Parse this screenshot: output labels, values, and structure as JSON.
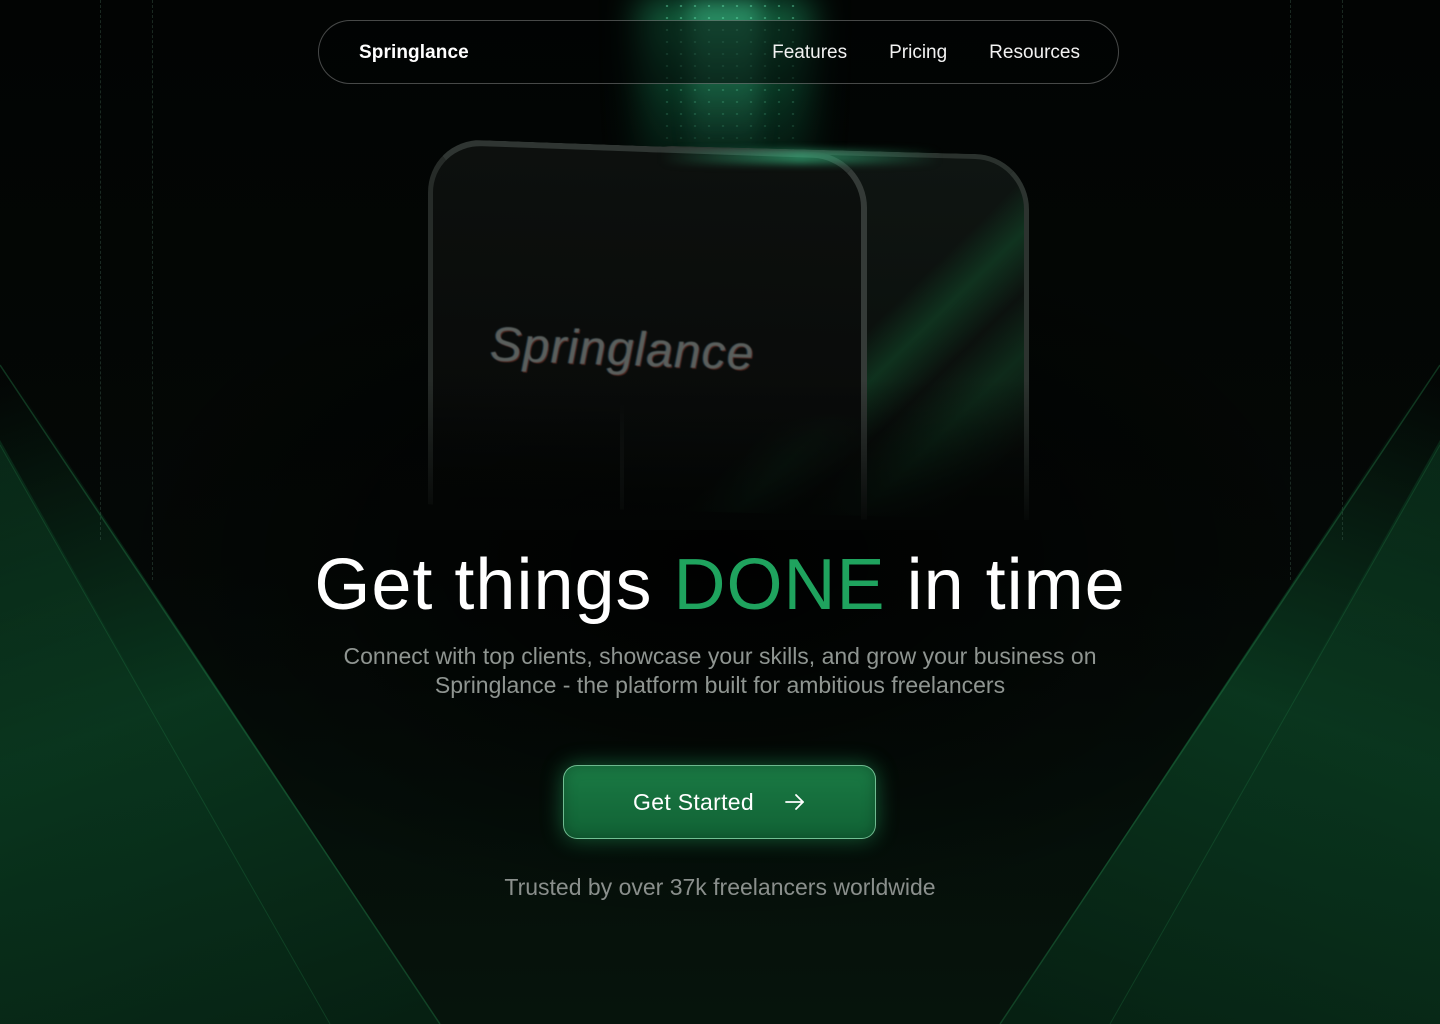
{
  "nav": {
    "brand": "Springlance",
    "links": [
      "Features",
      "Pricing",
      "Resources"
    ]
  },
  "hero": {
    "phone_logo": "Springlance",
    "headline_before": "Get things",
    "headline_accent": "DONE",
    "headline_after": "in time",
    "subtitle": "Connect with top clients, showcase your skills, and grow your business on Springlance - the platform built for ambitious freelancers",
    "cta_label": "Get Started",
    "cta_icon": "arrow-right-icon",
    "trust_text": "Trusted by over 37k freelancers worldwide"
  },
  "colors": {
    "background": "#030504",
    "accent": "#1fa35e",
    "button": "#137040",
    "text_muted": "#8f9591"
  }
}
